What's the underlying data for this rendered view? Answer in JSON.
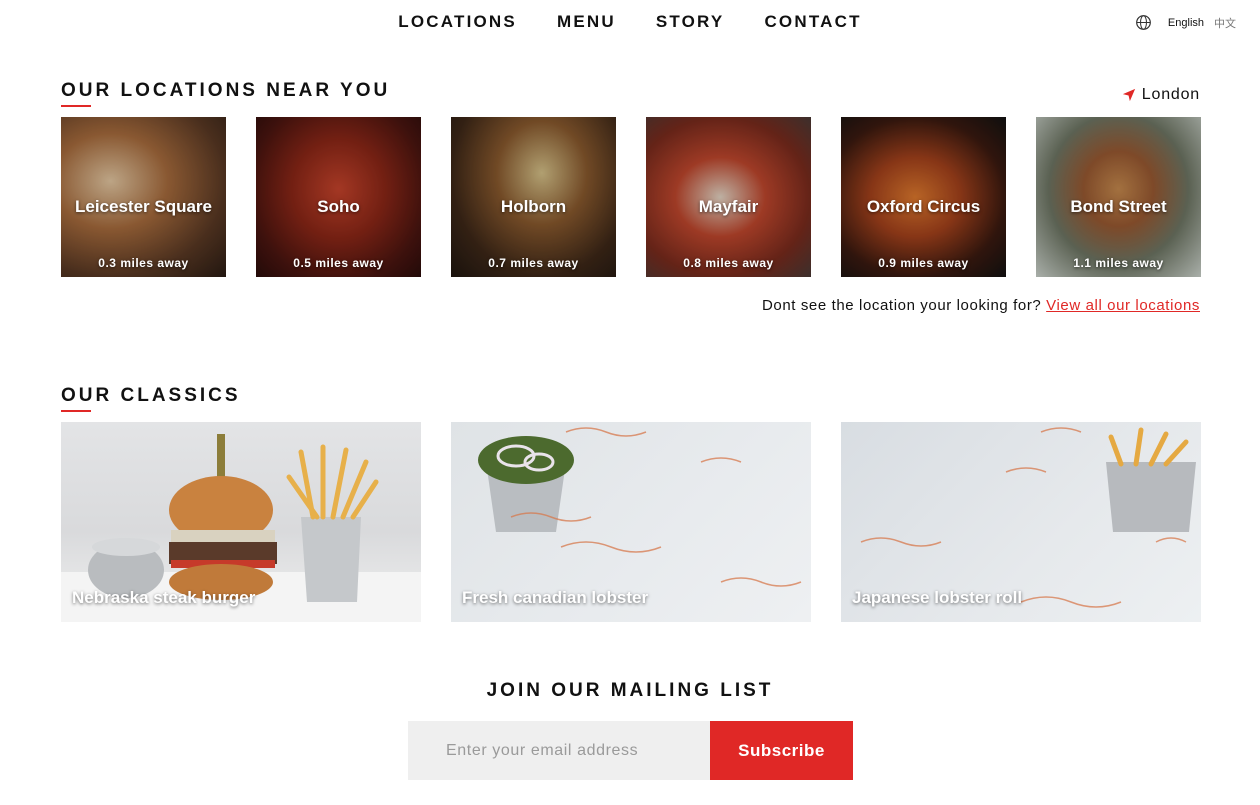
{
  "nav": {
    "links": [
      "LOCATIONS",
      "MENU",
      "STORY",
      "CONTACT"
    ],
    "languages": [
      "English",
      "中文"
    ]
  },
  "locations": {
    "title": "OUR LOCATIONS NEAR YOU",
    "city": "London",
    "cards": [
      {
        "name": "Leicester Square",
        "distance": "0.3 miles away"
      },
      {
        "name": "Soho",
        "distance": "0.5 miles away"
      },
      {
        "name": "Holborn",
        "distance": "0.7 miles away"
      },
      {
        "name": "Mayfair",
        "distance": "0.8 miles away"
      },
      {
        "name": "Oxford Circus",
        "distance": "0.9 miles away"
      },
      {
        "name": "Bond Street",
        "distance": "1.1 miles away"
      }
    ],
    "prompt_text": "Dont see the location your looking for?",
    "view_all_link": "View all our locations"
  },
  "classics": {
    "title": "OUR CLASSICS",
    "items": [
      "Nebraska steak burger",
      "Fresh canadian lobster",
      "Japanese lobster roll"
    ]
  },
  "mailing": {
    "title": "JOIN OUR MAILING LIST",
    "placeholder": "Enter your email address",
    "button": "Subscribe"
  },
  "colors": {
    "accent": "#e02826",
    "input_bg": "#efefef"
  }
}
